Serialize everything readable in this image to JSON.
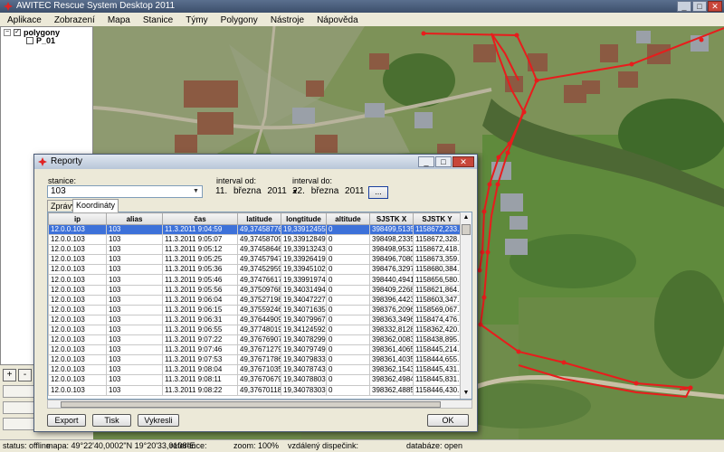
{
  "window": {
    "title": "AWITEC Rescue System Desktop 2011"
  },
  "menu": [
    "Aplikace",
    "Zobrazení",
    "Mapa",
    "Stanice",
    "Týmy",
    "Polygony",
    "Nástroje",
    "Nápověda"
  ],
  "tree": {
    "root_label": "polygony",
    "child_label": "P_01"
  },
  "status": {
    "state": "status: offline",
    "map_coords": "mapa: 49°22'40,0002\"N 19°20'33,0108\"E",
    "reference": "reference:",
    "zoom": "zoom: 100%",
    "remote": "vzdálený dispečink:",
    "database": "databáze: open"
  },
  "dialog": {
    "title": "Reporty",
    "station_label": "stanice:",
    "station_value": "103",
    "interval_from_label": "interval od:",
    "interval_from": {
      "day": "11.",
      "month": "března",
      "year": "2011"
    },
    "interval_to_label": "interval do:",
    "interval_to": {
      "day": "22.",
      "month": "března",
      "year": "2011"
    },
    "dots_label": "...",
    "tabs": [
      "Zprávy",
      "Koordináty"
    ],
    "columns": [
      "ip",
      "alias",
      "čas",
      "latitude",
      "longtitude",
      "altitude",
      "SJSTK X",
      "SJSTK Y"
    ],
    "rows": [
      [
        "12.0.0.103",
        "103",
        "11.3.2011 9:04:59",
        "49,37458776...",
        "19,33912455...",
        "0",
        "398499,5135...",
        "1158672,233..."
      ],
      [
        "12.0.0.103",
        "103",
        "11.3.2011 9:05:07",
        "49,37458709...",
        "19,33912849...",
        "0",
        "398498,2335...",
        "1158672,328..."
      ],
      [
        "12.0.0.103",
        "103",
        "11.3.2011 9:05:12",
        "49,37458646...",
        "19,33913243...",
        "0",
        "398498,9532...",
        "1158672,418..."
      ],
      [
        "12.0.0.103",
        "103",
        "11.3.2011 9:05:25",
        "49,37457947...",
        "19,33926419...",
        "0",
        "398496,7080...",
        "1158673,359..."
      ],
      [
        "12.0.0.103",
        "103",
        "11.3.2011 9:05:36",
        "49,37452959...",
        "19,33945102...",
        "0",
        "398476,3297...",
        "1158680,384..."
      ],
      [
        "12.0.0.103",
        "103",
        "11.3.2011 9:05:46",
        "49,37476617...",
        "19,33991974...",
        "0",
        "398440,4941...",
        "1158656,580..."
      ],
      [
        "12.0.0.103",
        "103",
        "11.3.2011 9:05:56",
        "49,37509768...",
        "19,34031494...",
        "0",
        "398409,2268...",
        "1158621,864..."
      ],
      [
        "12.0.0.103",
        "103",
        "11.3.2011 9:06:04",
        "49,37527198...",
        "19,34047227...",
        "0",
        "398396,4423...",
        "1158603,347..."
      ],
      [
        "12.0.0.103",
        "103",
        "11.3.2011 9:06:15",
        "49,37559246...",
        "19,34071635...",
        "0",
        "398376,2096...",
        "1158569,067..."
      ],
      [
        "12.0.0.103",
        "103",
        "11.3.2011 9:06:31",
        "49,37644909...",
        "19,34079967...",
        "0",
        "398363,3496...",
        "1158474,476..."
      ],
      [
        "12.0.0.103",
        "103",
        "11.3.2011 9:06:55",
        "49,37748019...",
        "19,34124592...",
        "0",
        "398332,8128...",
        "1158362,420..."
      ],
      [
        "12.0.0.103",
        "103",
        "11.3.2011 9:07:22",
        "49,37676907...",
        "19,34078299...",
        "0",
        "398362,0083...",
        "1158438,895..."
      ],
      [
        "12.0.0.103",
        "103",
        "11.3.2011 9:07:46",
        "49,37671279...",
        "19,34079749...",
        "0",
        "398361,4065...",
        "1158445,214..."
      ],
      [
        "12.0.0.103",
        "103",
        "11.3.2011 9:07:53",
        "49,37671786...",
        "19,34079833...",
        "0",
        "398361,4035...",
        "1158444,655..."
      ],
      [
        "12.0.0.103",
        "103",
        "11.3.2011 9:08:04",
        "49,37671035...",
        "19,34078743...",
        "0",
        "398362,1543...",
        "1158445,431..."
      ],
      [
        "12.0.0.103",
        "103",
        "11.3.2011 9:08:11",
        "49,37670679...",
        "19,34078803...",
        "0",
        "398362,4984...",
        "1158445,831..."
      ],
      [
        "12.0.0.103",
        "103",
        "11.3.2011 9:08:22",
        "49,37670118...",
        "19,34078303...",
        "0",
        "398362,4885...",
        "1158446,430..."
      ]
    ],
    "buttons": {
      "export": "Export",
      "print": "Tisk",
      "draw": "Vykresli",
      "ok": "OK"
    }
  },
  "colors": {
    "track": "#e81c1c",
    "selection": "#3d71d9",
    "map_base": "#6e8d4a"
  }
}
